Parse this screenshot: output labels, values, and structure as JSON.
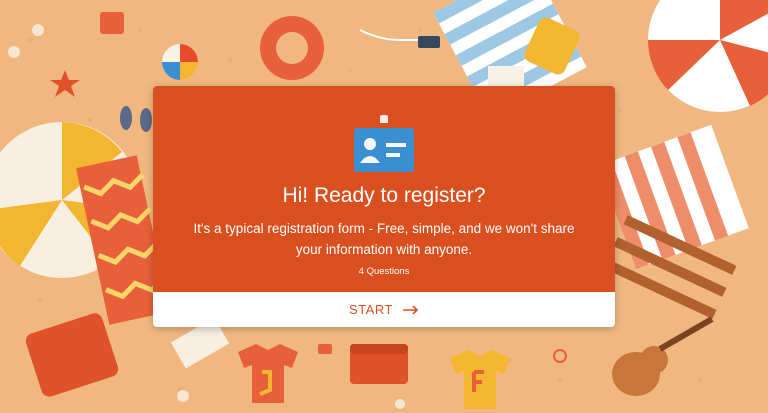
{
  "intro": {
    "title": "Hi! Ready to register?",
    "description": "It's a typical registration form - Free, simple, and we won't share your information with anyone.",
    "question_count": "4 Questions",
    "start_label": "START",
    "badge_icon": "id-card-icon",
    "arrow_icon": "arrow-right-icon"
  },
  "colors": {
    "accent": "#d94f1f",
    "card_bottom": "#ffffff",
    "background": "#f0b880"
  }
}
